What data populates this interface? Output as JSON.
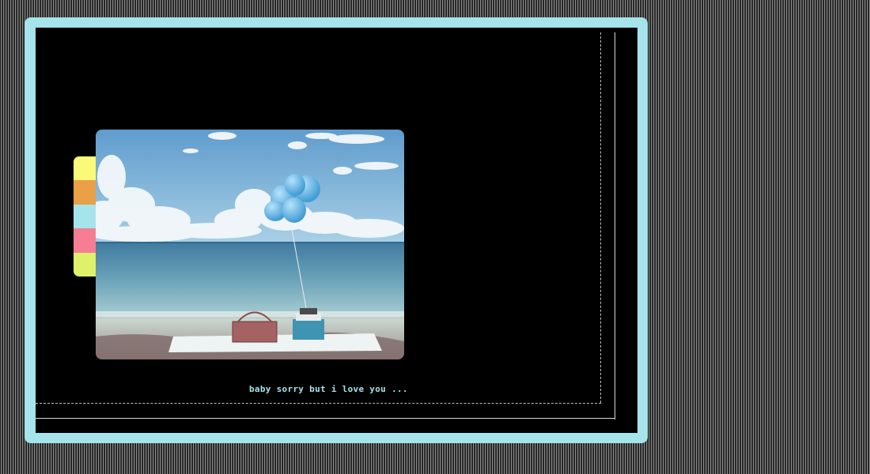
{
  "colors": {
    "frame": "#a4e4ea",
    "panel": "#000000",
    "caption": "#a4e4ea"
  },
  "tabs": [
    {
      "name": "tab-yellow",
      "color": "#fafa78"
    },
    {
      "name": "tab-orange",
      "color": "#e9a046"
    },
    {
      "name": "tab-cyan",
      "color": "#a4e4ea"
    },
    {
      "name": "tab-pink",
      "color": "#f57e93"
    },
    {
      "name": "tab-lime",
      "color": "#dff06a"
    }
  ],
  "photo": {
    "subject": "beach picnic with blue balloons"
  },
  "caption": {
    "text": "baby sorry but i love you ..."
  }
}
